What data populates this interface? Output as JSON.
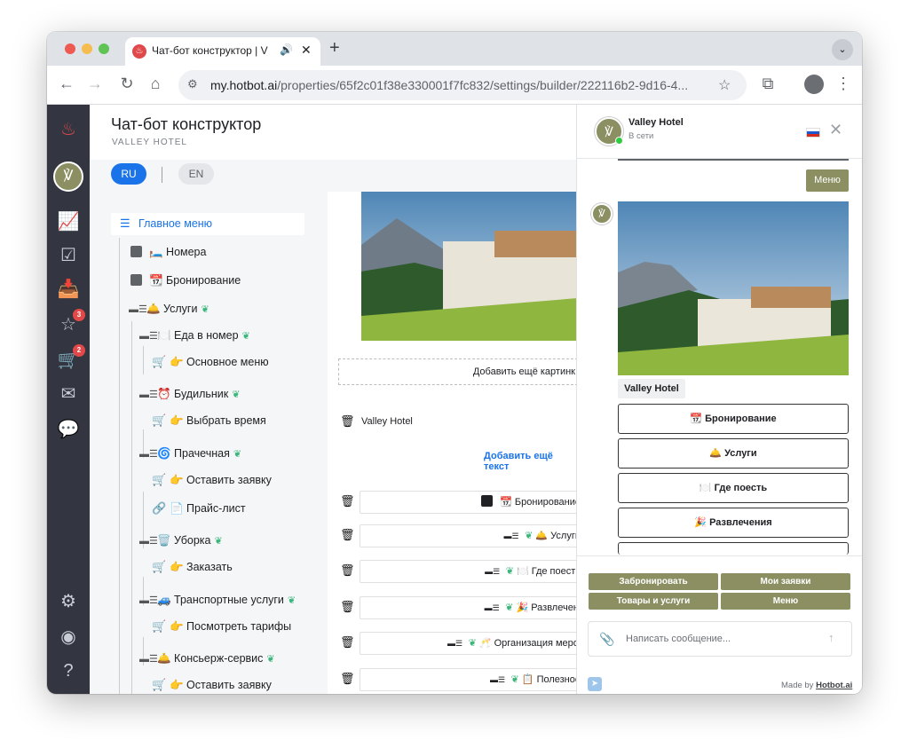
{
  "browser": {
    "tab_title": "Чат-бот конструктор | V",
    "url_host": "my.hotbot.ai",
    "url_path": "/properties/65f2c01f38e330001f7fc832/settings/builder/222116b2-9d16-4..."
  },
  "rail": {
    "badge_reviews": "3",
    "badge_cart": "2"
  },
  "page": {
    "title": "Чат-бот конструктор",
    "subtitle": "VALLEY HOTEL"
  },
  "lang": {
    "ru": "RU",
    "en": "EN"
  },
  "tree": {
    "root": "Главное меню",
    "items": [
      {
        "label": "🛏️ Номера"
      },
      {
        "label": "📆 Бронирование"
      },
      {
        "label": "🛎️ Услуги"
      },
      {
        "label": "🍽️ Еда в номер"
      },
      {
        "label": "👉 Основное меню"
      },
      {
        "label": "⏰ Будильник"
      },
      {
        "label": "👉 Выбрать время"
      },
      {
        "label": "🌀 Прачечная"
      },
      {
        "label": "👉 Оставить заявку"
      },
      {
        "label": "📄 Прайс-лист"
      },
      {
        "label": "🗑️ Уборка"
      },
      {
        "label": "👉 Заказать"
      },
      {
        "label": "🚙 Транспортные услуги"
      },
      {
        "label": "👉 Посмотреть тарифы"
      },
      {
        "label": "🛎️ Консьерж-сервис"
      },
      {
        "label": "👉 Оставить заявку"
      }
    ]
  },
  "editor": {
    "add_image": "Добавить ещё картинк",
    "text_value": "Valley Hotel",
    "add_text": "Добавить ещё текст",
    "buttons": [
      {
        "label": "📆 Бронирование"
      },
      {
        "label": "🛎️ Услуги"
      },
      {
        "label": "🍽️ Где поесть"
      },
      {
        "label": "🎉 Развлечения"
      },
      {
        "label": "🥂 Организация меропр"
      },
      {
        "label": "📋 Полезное"
      }
    ]
  },
  "chat": {
    "hotel_name": "Valley Hotel",
    "status": "В сети",
    "menu_bubble": "Меню",
    "caption": "Valley Hotel",
    "options": [
      {
        "label": "📆 Бронирование"
      },
      {
        "label": "🛎️ Услуги"
      },
      {
        "label": "🍽️ Где поесть"
      },
      {
        "label": "🎉 Развлечения"
      }
    ],
    "quick_replies": [
      "Забронировать",
      "Мои заявки",
      "Товары и услуги",
      "Меню"
    ],
    "input_placeholder": "Написать сообщение...",
    "made_by": "Made by",
    "made_by_link": "Hotbot.ai"
  },
  "colors": {
    "accent_blue": "#1a73e8",
    "olive": "#8b8f62",
    "rail_bg": "#333640"
  }
}
